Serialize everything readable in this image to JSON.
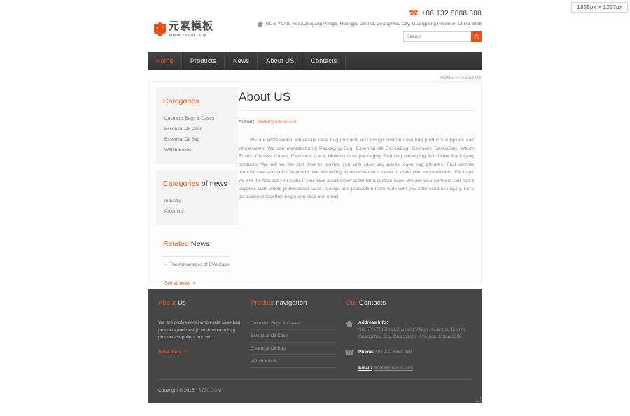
{
  "badge": {
    "dimensions": "1855px × 1227px"
  },
  "header": {
    "logo": {
      "cn_name": "元素模板",
      "url": "WWW.YS720.COM",
      "icon": "logo-mark-icon"
    },
    "phone": "+86 132 8888 888",
    "address": "NO.5 Ys720 Road,Zhujiang Village, Huangpu District, Guangzhou City, Guangdong Province, China 8888",
    "search": {
      "placeholder": "Search",
      "value": "",
      "button_icon": "search-icon"
    }
  },
  "nav": {
    "items": [
      {
        "label": "Home",
        "active": true
      },
      {
        "label": "Products",
        "active": false
      },
      {
        "label": "News",
        "active": false
      },
      {
        "label": "About US",
        "active": false
      },
      {
        "label": "Contacts",
        "active": false
      }
    ]
  },
  "breadcrumb": {
    "text": "HOME >> About US"
  },
  "sidebar": {
    "categories": {
      "title_plain": "Categories",
      "items": [
        "Cosmetic Bags & Cases",
        "Essential Oil Case",
        "Essential Oil Bag",
        "Watch Boxes"
      ]
    },
    "news_categories": {
      "title_hl": "Categories",
      "title_rest": " of news",
      "items": [
        "Industry",
        "Products"
      ]
    },
    "related_news": {
      "title_hl": "Related",
      "title_rest": " News",
      "items": [
        "The Advantages of EVA Case"
      ],
      "see_all": "See all news",
      "see_all_chevron": "»"
    }
  },
  "article": {
    "title": "About US",
    "author_label": "Author：",
    "author_email": "88888@admin.com",
    "body": "We are professional wholesale case bag products and design custom case bag products suppliers and wholesalers. We can manufacturing Packaging Bag, Essential Oil Case&Bag, Cosmetic Case&Bag, Watch Boxes, Glasses Cases, Electronic Case, Molding case packaging, Soft bag packaging And Other Packaging products. We will be the first time to provide you with case bag prices, case bag pictures. Fast sample manufacture and quick shipment. We are willing to do whatever it takes to meet your requirements. We hope we are the first call you make if you have a customer/ order for a custom case. We are your partners, not just a supplier. With whole professional sales , design and production team work with you after send us inquiry. Let's do business together begin one click and email."
  },
  "footer": {
    "about": {
      "title_hl": "About",
      "title_rest": " Us",
      "text": "We are professional wholesale case bag products and design custom case bag products suppliers and wh...",
      "read_more": "Read more",
      "read_more_chevron": "»"
    },
    "product_nav": {
      "title_hl": "Product",
      "title_rest": " navigation",
      "items": [
        "Cosmetic Bags & Cases",
        "Essential Oil Case",
        "Essential Oil Bag",
        "Watch Boxes"
      ]
    },
    "contacts": {
      "title_hl": "Our",
      "title_rest": " Contacts",
      "address_label": "Address Info：",
      "address_value": "NO.5 Ys720 Road,Zhujiang Village, Huangpu District, Guangzhou City, Guangdong Province, China 8888",
      "phone_label": "Phone:",
      "phone_value": "+86 132 8888 888",
      "email_label": "Email:",
      "email_value": "88888@admin.com"
    },
    "copyright_prefix": "Copyright © 2016 ",
    "copyright_site": "YS720.COM"
  },
  "colors": {
    "accent": "#ee5013",
    "nav_bg": "#383838",
    "footer_bg": "#464646",
    "text_dark": "#3a3a3a",
    "text_muted": "#8a8a8a"
  }
}
